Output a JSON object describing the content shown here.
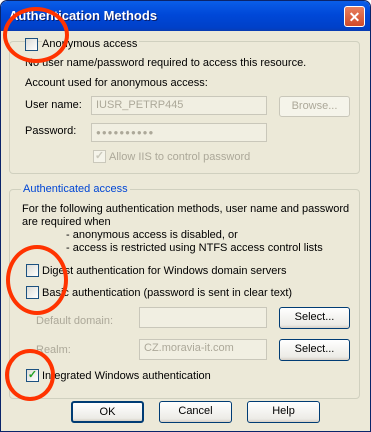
{
  "window": {
    "title": "Authentication Methods",
    "close_symbol": "✕"
  },
  "anonymous": {
    "checkbox_label": "Anonymous access",
    "checked": false,
    "description": "No user name/password required to access this resource.",
    "account_caption": "Account used for anonymous access:",
    "username_label": "User name:",
    "username_value": "IUSR_PETRP445",
    "browse_label": "Browse...",
    "password_label": "Password:",
    "password_value": "●●●●●●●●●●",
    "allow_iis_label": "Allow IIS to control password",
    "allow_iis_checked": true
  },
  "authenticated": {
    "legend": "Authenticated access",
    "desc_line1": "For the following authentication methods, user name and password",
    "desc_line2": "are required when",
    "desc_line3": "- anonymous access is disabled, or",
    "desc_line4": "- access is restricted using NTFS access control lists",
    "digest_label": "Digest authentication for Windows domain servers",
    "digest_checked": false,
    "basic_label": "Basic authentication (password is sent in clear text)",
    "basic_checked": false,
    "default_domain_label": "Default domain:",
    "default_domain_value": "",
    "select_label": "Select...",
    "realm_label": "Realm:",
    "realm_value": "CZ.moravia-it.com",
    "integrated_label": "Integrated Windows authentication",
    "integrated_checked": true
  },
  "footer": {
    "ok_label": "OK",
    "cancel_label": "Cancel",
    "help_label": "Help"
  },
  "colors": {
    "annotation": "#ff3300",
    "titlebar": "#0048d8",
    "legend": "#0046d5"
  }
}
